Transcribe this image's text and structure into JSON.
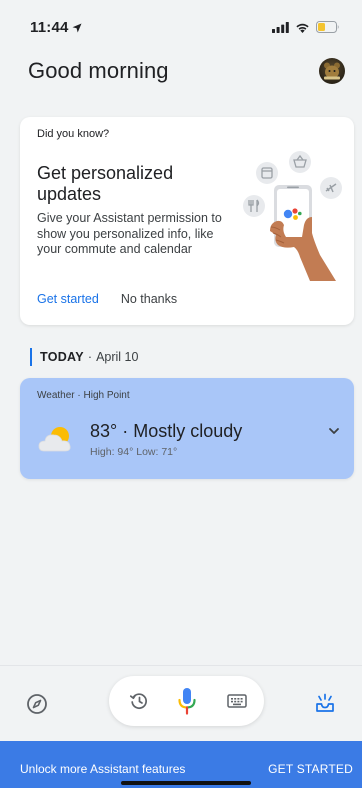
{
  "status_bar": {
    "time": "11:44",
    "icons": [
      "location-arrow-icon",
      "cellular-signal-icon",
      "wifi-icon",
      "battery-icon"
    ],
    "battery_color": "#f4c430"
  },
  "header": {
    "greeting": "Good morning",
    "avatar_icon": "avatar"
  },
  "did_you_know": {
    "label": "Did you know?",
    "title": "Get personalized updates",
    "body": "Give your Assistant permission to show you personalized info, like your commute and calendar",
    "primary_action": "Get started",
    "secondary_action": "No thanks",
    "illustration": "hand-holding-phone-illustration"
  },
  "today": {
    "label": "TODAY",
    "separator": "·",
    "date": "April 10"
  },
  "weather": {
    "label": "Weather · High Point",
    "summary": "83° · Mostly cloudy",
    "hilo": "High: 94° Low: 71°",
    "icon": "partly-cloudy-icon",
    "card_color": "#a9c6f8"
  },
  "toolbar": {
    "explore_icon": "compass-icon",
    "history_icon": "history-icon",
    "mic_icon": "microphone-icon",
    "keyboard_icon": "keyboard-icon",
    "updates_icon": "updates-inbox-icon"
  },
  "promo": {
    "text": "Unlock more Assistant features",
    "cta": "GET STARTED",
    "color": "#3b7be5"
  },
  "colors": {
    "accent": "#1a73e8",
    "background": "#f1f3f4"
  }
}
